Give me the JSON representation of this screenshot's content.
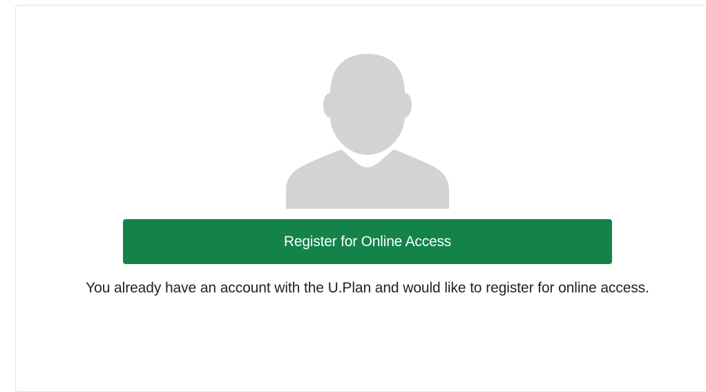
{
  "card": {
    "avatar_icon": "user-silhouette-icon",
    "button_label": "Register for Online Access",
    "description": "You already have an account with the U.Plan and would like to register for online access."
  },
  "colors": {
    "button_bg": "#13834a",
    "button_text": "#ffffff",
    "avatar": "#d3d3d3",
    "text": "#222222"
  }
}
